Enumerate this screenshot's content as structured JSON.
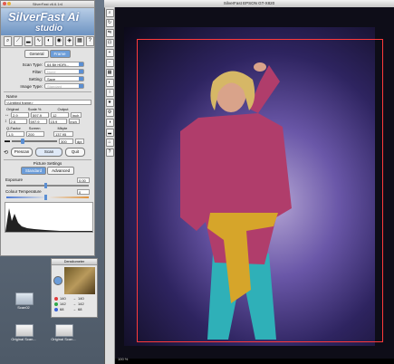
{
  "panel": {
    "title": "SilverFast v6.6.1r4",
    "logo_main": "SilverFast Ai",
    "logo_sub": "studio",
    "tabs": [
      "General",
      "Frame"
    ],
    "scan_type": {
      "label": "Scan Type:",
      "value": "64 Bit HDRi..."
    },
    "filter": {
      "label": "Filter:",
      "value": "None"
    },
    "setting": {
      "label": "Setting:",
      "value": "Save"
    },
    "image_type": {
      "label": "Image Type:",
      "value": "Standard"
    },
    "name_label": "Name",
    "name_value": "<Untitled frame>",
    "col_original": "Original",
    "col_scale": "Scale %",
    "col_output": "Output",
    "row1": {
      "orig": "2.9",
      "scale": "597.9",
      "out": "12",
      "unit": "inch"
    },
    "row2": {
      "orig": "2.6",
      "scale": "597.9",
      "out": "15.9",
      "unit": "inch"
    },
    "qfactor_label": "Q-Factor",
    "screen_label": "Screen",
    "mbyte_label": "Mbyte",
    "qfactor": "1.5",
    "screen": "200",
    "mbyte": "137.95",
    "res_value": "300",
    "res_unit": "dpi",
    "buttons": {
      "prescan": "Prescan",
      "scan": "Scan",
      "quit": "Quit"
    },
    "picture_settings": "Picture Settings",
    "ps_tabs": [
      "Standard",
      "Advanced"
    ],
    "exposure_label": "Exposure",
    "exposure_value": "0.00",
    "colour_temp_label": "Colour Temperature",
    "colour_temp_value": "0"
  },
  "scan_window": {
    "title": "SilverFast EPSON GT-X820",
    "zoom": "100 %"
  },
  "densitometer": {
    "title": "Densitometer",
    "rows": [
      {
        "color": "#e23b3b",
        "left": "140",
        "right": "140"
      },
      {
        "color": "#2fa84a",
        "left": "142",
        "right": "142"
      },
      {
        "color": "#3a62d6",
        "left": "68",
        "right": "68"
      }
    ]
  },
  "desktop_icons": [
    "Scan02",
    "Original Scan...",
    "Original Scan..."
  ]
}
